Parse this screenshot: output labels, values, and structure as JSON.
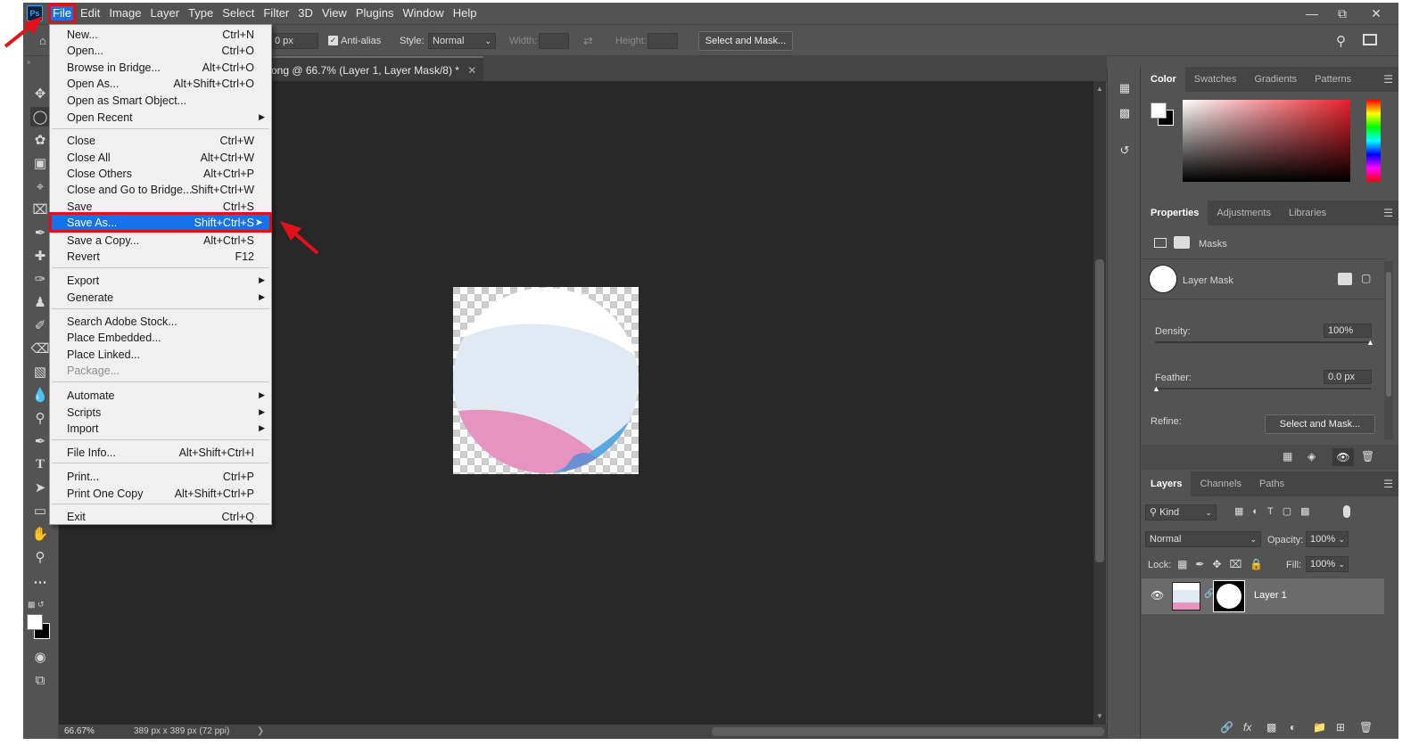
{
  "menubar": {
    "logo": "Ps",
    "items": [
      "File",
      "Edit",
      "Image",
      "Layer",
      "Type",
      "Select",
      "Filter",
      "3D",
      "View",
      "Plugins",
      "Window",
      "Help"
    ]
  },
  "options": {
    "feather_value": "0 px",
    "antialias": "Anti-alias",
    "style_label": "Style:",
    "style_value": "Normal",
    "width_label": "Width:",
    "height_label": "Height:",
    "select_mask": "Select and Mask..."
  },
  "document": {
    "tab_title": "ong @ 66.7% (Layer 1, Layer Mask/8) *",
    "zoom": "66.67%",
    "size_info": "389 px x 389 px (72 ppi)"
  },
  "file_menu": {
    "items": [
      {
        "label": "New...",
        "shortcut": "Ctrl+N"
      },
      {
        "label": "Open...",
        "shortcut": "Ctrl+O"
      },
      {
        "label": "Browse in Bridge...",
        "shortcut": "Alt+Ctrl+O"
      },
      {
        "label": "Open As...",
        "shortcut": "Alt+Shift+Ctrl+O"
      },
      {
        "label": "Open as Smart Object...",
        "shortcut": ""
      },
      {
        "label": "Open Recent",
        "shortcut": ""
      },
      {
        "label": "Close",
        "shortcut": "Ctrl+W"
      },
      {
        "label": "Close All",
        "shortcut": "Alt+Ctrl+W"
      },
      {
        "label": "Close Others",
        "shortcut": "Alt+Ctrl+P"
      },
      {
        "label": "Close and Go to Bridge...",
        "shortcut": "Shift+Ctrl+W"
      },
      {
        "label": "Save",
        "shortcut": "Ctrl+S"
      },
      {
        "label": "Save As...",
        "shortcut": "Shift+Ctrl+S"
      },
      {
        "label": "Save a Copy...",
        "shortcut": "Alt+Ctrl+S"
      },
      {
        "label": "Revert",
        "shortcut": "F12"
      },
      {
        "label": "Export",
        "shortcut": ""
      },
      {
        "label": "Generate",
        "shortcut": ""
      },
      {
        "label": "Search Adobe Stock...",
        "shortcut": ""
      },
      {
        "label": "Place Embedded...",
        "shortcut": ""
      },
      {
        "label": "Place Linked...",
        "shortcut": ""
      },
      {
        "label": "Package...",
        "shortcut": ""
      },
      {
        "label": "Automate",
        "shortcut": ""
      },
      {
        "label": "Scripts",
        "shortcut": ""
      },
      {
        "label": "Import",
        "shortcut": ""
      },
      {
        "label": "File Info...",
        "shortcut": "Alt+Shift+Ctrl+I"
      },
      {
        "label": "Print...",
        "shortcut": "Ctrl+P"
      },
      {
        "label": "Print One Copy",
        "shortcut": "Alt+Shift+Ctrl+P"
      },
      {
        "label": "Exit",
        "shortcut": "Ctrl+Q"
      }
    ]
  },
  "color_panel": {
    "tabs": [
      "Color",
      "Swatches",
      "Gradients",
      "Patterns"
    ]
  },
  "properties_panel": {
    "tabs": [
      "Properties",
      "Adjustments",
      "Libraries"
    ],
    "masks_label": "Masks",
    "layer_mask_label": "Layer Mask",
    "density_label": "Density:",
    "density_value": "100%",
    "feather_label": "Feather:",
    "feather_value": "0.0 px",
    "refine_label": "Refine:",
    "select_mask": "Select and Mask..."
  },
  "layers_panel": {
    "tabs": [
      "Layers",
      "Channels",
      "Paths"
    ],
    "kind_label": "Kind",
    "blend_mode": "Normal",
    "opacity_label": "Opacity:",
    "opacity_value": "100%",
    "lock_label": "Lock:",
    "fill_label": "Fill:",
    "fill_value": "100%",
    "layer_name": "Layer 1"
  },
  "colors": {
    "highlight": "#1473e6",
    "annotation": "#e3101a"
  }
}
